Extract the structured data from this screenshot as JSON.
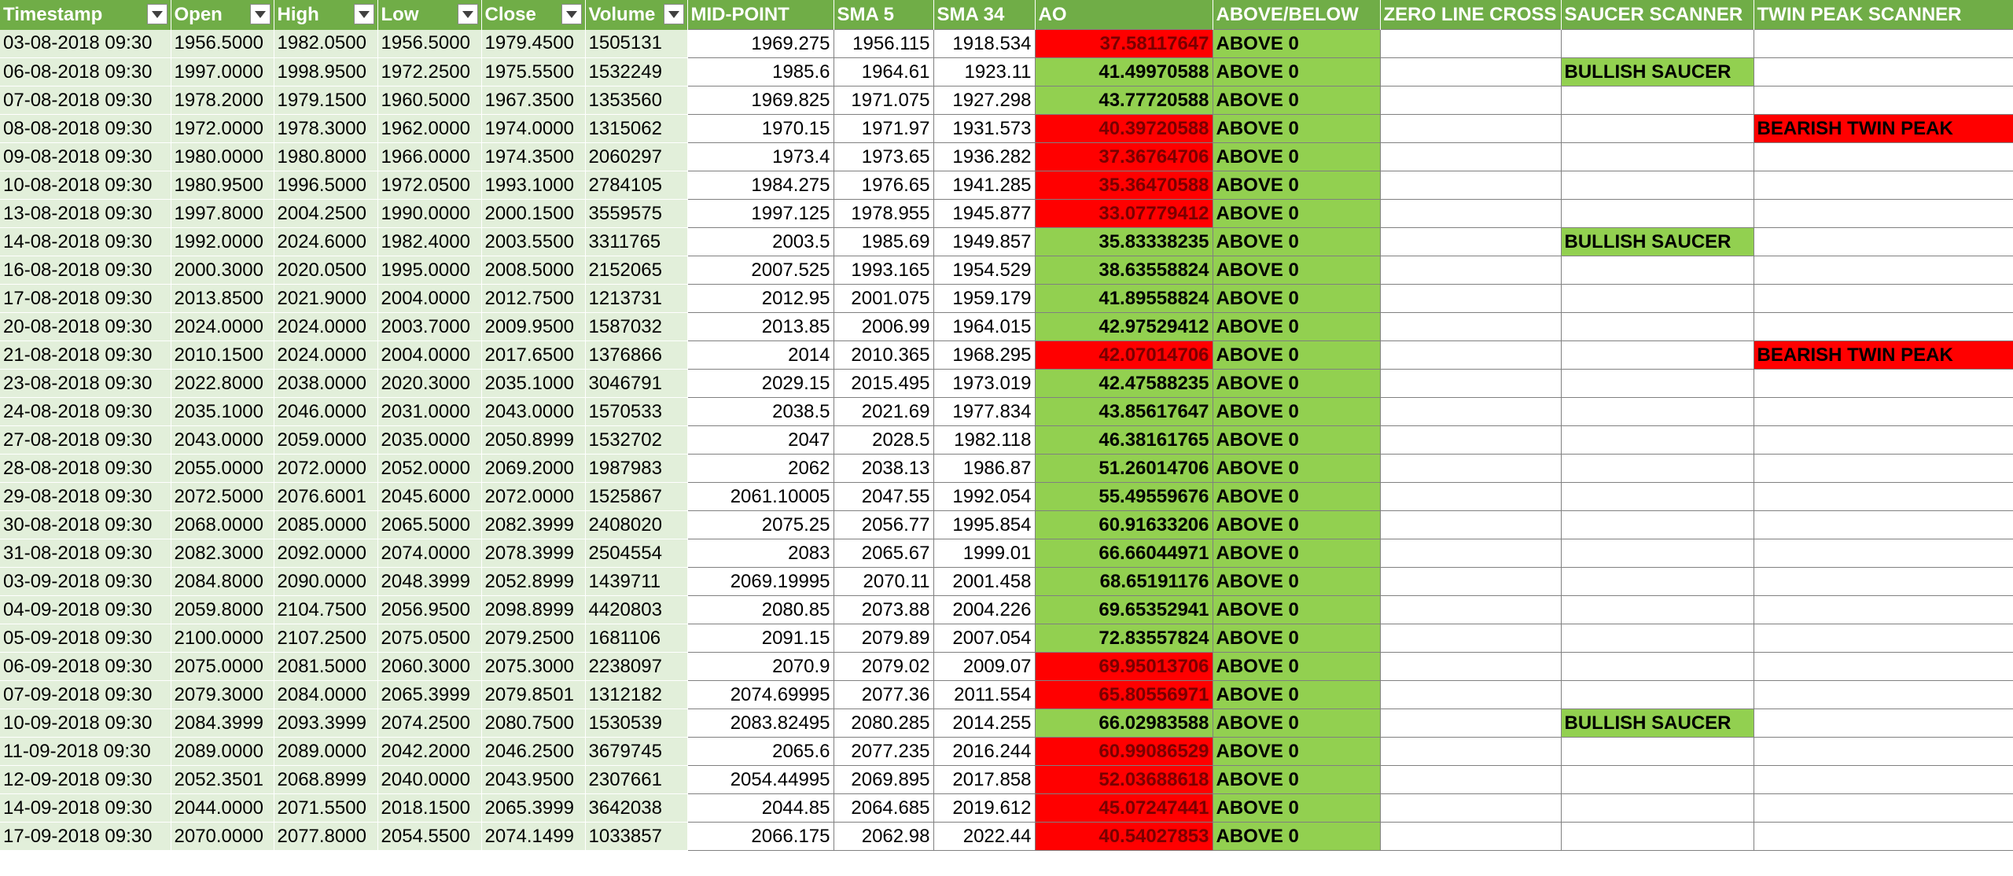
{
  "colors": {
    "header_bg": "#70ad47",
    "band_bg": "#e2efda",
    "green_fill": "#92d050",
    "red_fill": "#ff0000"
  },
  "icons": {
    "filter": "filter-dropdown-arrow-icon"
  },
  "headers": [
    {
      "label": "Timestamp",
      "filter": true
    },
    {
      "label": "Open",
      "filter": true
    },
    {
      "label": "High",
      "filter": true
    },
    {
      "label": "Low",
      "filter": true
    },
    {
      "label": "Close",
      "filter": true
    },
    {
      "label": "Volume",
      "filter": true
    },
    {
      "label": "MID-POINT",
      "filter": false
    },
    {
      "label": "SMA 5",
      "filter": false
    },
    {
      "label": "SMA 34",
      "filter": false
    },
    {
      "label": "AO",
      "filter": false
    },
    {
      "label": "ABOVE/BELOW",
      "filter": false
    },
    {
      "label": "ZERO LINE CROSS",
      "filter": false
    },
    {
      "label": "SAUCER SCANNER",
      "filter": false
    },
    {
      "label": "TWIN PEAK SCANNER",
      "filter": false
    }
  ],
  "rows": [
    {
      "ts": "03-08-2018 09:30",
      "open": "1956.5000",
      "high": "1982.0500",
      "low": "1956.5000",
      "close": "1979.4500",
      "volume": "1505131",
      "mid": "1969.275",
      "sma5": "1956.115",
      "sma34": "1918.534",
      "ao": "37.58117647",
      "ao_color": "red",
      "ab": "ABOVE 0",
      "zlc": "",
      "saucer": "",
      "twin": ""
    },
    {
      "ts": "06-08-2018 09:30",
      "open": "1997.0000",
      "high": "1998.9500",
      "low": "1972.2500",
      "close": "1975.5500",
      "volume": "1532249",
      "mid": "1985.6",
      "sma5": "1964.61",
      "sma34": "1923.11",
      "ao": "41.49970588",
      "ao_color": "green",
      "ab": "ABOVE 0",
      "zlc": "",
      "saucer": "BULLISH SAUCER",
      "twin": ""
    },
    {
      "ts": "07-08-2018 09:30",
      "open": "1978.2000",
      "high": "1979.1500",
      "low": "1960.5000",
      "close": "1967.3500",
      "volume": "1353560",
      "mid": "1969.825",
      "sma5": "1971.075",
      "sma34": "1927.298",
      "ao": "43.77720588",
      "ao_color": "green",
      "ab": "ABOVE 0",
      "zlc": "",
      "saucer": "",
      "twin": ""
    },
    {
      "ts": "08-08-2018 09:30",
      "open": "1972.0000",
      "high": "1978.3000",
      "low": "1962.0000",
      "close": "1974.0000",
      "volume": "1315062",
      "mid": "1970.15",
      "sma5": "1971.97",
      "sma34": "1931.573",
      "ao": "40.39720588",
      "ao_color": "red",
      "ab": "ABOVE 0",
      "zlc": "",
      "saucer": "",
      "twin": "BEARISH TWIN PEAK"
    },
    {
      "ts": "09-08-2018 09:30",
      "open": "1980.0000",
      "high": "1980.8000",
      "low": "1966.0000",
      "close": "1974.3500",
      "volume": "2060297",
      "mid": "1973.4",
      "sma5": "1973.65",
      "sma34": "1936.282",
      "ao": "37.36764706",
      "ao_color": "red",
      "ab": "ABOVE 0",
      "zlc": "",
      "saucer": "",
      "twin": ""
    },
    {
      "ts": "10-08-2018 09:30",
      "open": "1980.9500",
      "high": "1996.5000",
      "low": "1972.0500",
      "close": "1993.1000",
      "volume": "2784105",
      "mid": "1984.275",
      "sma5": "1976.65",
      "sma34": "1941.285",
      "ao": "35.36470588",
      "ao_color": "red",
      "ab": "ABOVE 0",
      "zlc": "",
      "saucer": "",
      "twin": ""
    },
    {
      "ts": "13-08-2018 09:30",
      "open": "1997.8000",
      "high": "2004.2500",
      "low": "1990.0000",
      "close": "2000.1500",
      "volume": "3559575",
      "mid": "1997.125",
      "sma5": "1978.955",
      "sma34": "1945.877",
      "ao": "33.07779412",
      "ao_color": "red",
      "ab": "ABOVE 0",
      "zlc": "",
      "saucer": "",
      "twin": ""
    },
    {
      "ts": "14-08-2018 09:30",
      "open": "1992.0000",
      "high": "2024.6000",
      "low": "1982.4000",
      "close": "2003.5500",
      "volume": "3311765",
      "mid": "2003.5",
      "sma5": "1985.69",
      "sma34": "1949.857",
      "ao": "35.83338235",
      "ao_color": "green",
      "ab": "ABOVE 0",
      "zlc": "",
      "saucer": "BULLISH SAUCER",
      "twin": ""
    },
    {
      "ts": "16-08-2018 09:30",
      "open": "2000.3000",
      "high": "2020.0500",
      "low": "1995.0000",
      "close": "2008.5000",
      "volume": "2152065",
      "mid": "2007.525",
      "sma5": "1993.165",
      "sma34": "1954.529",
      "ao": "38.63558824",
      "ao_color": "green",
      "ab": "ABOVE 0",
      "zlc": "",
      "saucer": "",
      "twin": ""
    },
    {
      "ts": "17-08-2018 09:30",
      "open": "2013.8500",
      "high": "2021.9000",
      "low": "2004.0000",
      "close": "2012.7500",
      "volume": "1213731",
      "mid": "2012.95",
      "sma5": "2001.075",
      "sma34": "1959.179",
      "ao": "41.89558824",
      "ao_color": "green",
      "ab": "ABOVE 0",
      "zlc": "",
      "saucer": "",
      "twin": ""
    },
    {
      "ts": "20-08-2018 09:30",
      "open": "2024.0000",
      "high": "2024.0000",
      "low": "2003.7000",
      "close": "2009.9500",
      "volume": "1587032",
      "mid": "2013.85",
      "sma5": "2006.99",
      "sma34": "1964.015",
      "ao": "42.97529412",
      "ao_color": "green",
      "ab": "ABOVE 0",
      "zlc": "",
      "saucer": "",
      "twin": ""
    },
    {
      "ts": "21-08-2018 09:30",
      "open": "2010.1500",
      "high": "2024.0000",
      "low": "2004.0000",
      "close": "2017.6500",
      "volume": "1376866",
      "mid": "2014",
      "sma5": "2010.365",
      "sma34": "1968.295",
      "ao": "42.07014706",
      "ao_color": "red",
      "ab": "ABOVE 0",
      "zlc": "",
      "saucer": "",
      "twin": "BEARISH TWIN PEAK"
    },
    {
      "ts": "23-08-2018 09:30",
      "open": "2022.8000",
      "high": "2038.0000",
      "low": "2020.3000",
      "close": "2035.1000",
      "volume": "3046791",
      "mid": "2029.15",
      "sma5": "2015.495",
      "sma34": "1973.019",
      "ao": "42.47588235",
      "ao_color": "green",
      "ab": "ABOVE 0",
      "zlc": "",
      "saucer": "",
      "twin": ""
    },
    {
      "ts": "24-08-2018 09:30",
      "open": "2035.1000",
      "high": "2046.0000",
      "low": "2031.0000",
      "close": "2043.0000",
      "volume": "1570533",
      "mid": "2038.5",
      "sma5": "2021.69",
      "sma34": "1977.834",
      "ao": "43.85617647",
      "ao_color": "green",
      "ab": "ABOVE 0",
      "zlc": "",
      "saucer": "",
      "twin": ""
    },
    {
      "ts": "27-08-2018 09:30",
      "open": "2043.0000",
      "high": "2059.0000",
      "low": "2035.0000",
      "close": "2050.8999",
      "volume": "1532702",
      "mid": "2047",
      "sma5": "2028.5",
      "sma34": "1982.118",
      "ao": "46.38161765",
      "ao_color": "green",
      "ab": "ABOVE 0",
      "zlc": "",
      "saucer": "",
      "twin": ""
    },
    {
      "ts": "28-08-2018 09:30",
      "open": "2055.0000",
      "high": "2072.0000",
      "low": "2052.0000",
      "close": "2069.2000",
      "volume": "1987983",
      "mid": "2062",
      "sma5": "2038.13",
      "sma34": "1986.87",
      "ao": "51.26014706",
      "ao_color": "green",
      "ab": "ABOVE 0",
      "zlc": "",
      "saucer": "",
      "twin": ""
    },
    {
      "ts": "29-08-2018 09:30",
      "open": "2072.5000",
      "high": "2076.6001",
      "low": "2045.6000",
      "close": "2072.0000",
      "volume": "1525867",
      "mid": "2061.10005",
      "sma5": "2047.55",
      "sma34": "1992.054",
      "ao": "55.49559676",
      "ao_color": "green",
      "ab": "ABOVE 0",
      "zlc": "",
      "saucer": "",
      "twin": ""
    },
    {
      "ts": "30-08-2018 09:30",
      "open": "2068.0000",
      "high": "2085.0000",
      "low": "2065.5000",
      "close": "2082.3999",
      "volume": "2408020",
      "mid": "2075.25",
      "sma5": "2056.77",
      "sma34": "1995.854",
      "ao": "60.91633206",
      "ao_color": "green",
      "ab": "ABOVE 0",
      "zlc": "",
      "saucer": "",
      "twin": ""
    },
    {
      "ts": "31-08-2018 09:30",
      "open": "2082.3000",
      "high": "2092.0000",
      "low": "2074.0000",
      "close": "2078.3999",
      "volume": "2504554",
      "mid": "2083",
      "sma5": "2065.67",
      "sma34": "1999.01",
      "ao": "66.66044971",
      "ao_color": "green",
      "ab": "ABOVE 0",
      "zlc": "",
      "saucer": "",
      "twin": ""
    },
    {
      "ts": "03-09-2018 09:30",
      "open": "2084.8000",
      "high": "2090.0000",
      "low": "2048.3999",
      "close": "2052.8999",
      "volume": "1439711",
      "mid": "2069.19995",
      "sma5": "2070.11",
      "sma34": "2001.458",
      "ao": "68.65191176",
      "ao_color": "green",
      "ab": "ABOVE 0",
      "zlc": "",
      "saucer": "",
      "twin": ""
    },
    {
      "ts": "04-09-2018 09:30",
      "open": "2059.8000",
      "high": "2104.7500",
      "low": "2056.9500",
      "close": "2098.8999",
      "volume": "4420803",
      "mid": "2080.85",
      "sma5": "2073.88",
      "sma34": "2004.226",
      "ao": "69.65352941",
      "ao_color": "green",
      "ab": "ABOVE 0",
      "zlc": "",
      "saucer": "",
      "twin": ""
    },
    {
      "ts": "05-09-2018 09:30",
      "open": "2100.0000",
      "high": "2107.2500",
      "low": "2075.0500",
      "close": "2079.2500",
      "volume": "1681106",
      "mid": "2091.15",
      "sma5": "2079.89",
      "sma34": "2007.054",
      "ao": "72.83557824",
      "ao_color": "green",
      "ab": "ABOVE 0",
      "zlc": "",
      "saucer": "",
      "twin": ""
    },
    {
      "ts": "06-09-2018 09:30",
      "open": "2075.0000",
      "high": "2081.5000",
      "low": "2060.3000",
      "close": "2075.3000",
      "volume": "2238097",
      "mid": "2070.9",
      "sma5": "2079.02",
      "sma34": "2009.07",
      "ao": "69.95013706",
      "ao_color": "red",
      "ab": "ABOVE 0",
      "zlc": "",
      "saucer": "",
      "twin": ""
    },
    {
      "ts": "07-09-2018 09:30",
      "open": "2079.3000",
      "high": "2084.0000",
      "low": "2065.3999",
      "close": "2079.8501",
      "volume": "1312182",
      "mid": "2074.69995",
      "sma5": "2077.36",
      "sma34": "2011.554",
      "ao": "65.80556971",
      "ao_color": "red",
      "ab": "ABOVE 0",
      "zlc": "",
      "saucer": "",
      "twin": ""
    },
    {
      "ts": "10-09-2018 09:30",
      "open": "2084.3999",
      "high": "2093.3999",
      "low": "2074.2500",
      "close": "2080.7500",
      "volume": "1530539",
      "mid": "2083.82495",
      "sma5": "2080.285",
      "sma34": "2014.255",
      "ao": "66.02983588",
      "ao_color": "green",
      "ab": "ABOVE 0",
      "zlc": "",
      "saucer": "BULLISH SAUCER",
      "twin": ""
    },
    {
      "ts": "11-09-2018 09:30",
      "open": "2089.0000",
      "high": "2089.0000",
      "low": "2042.2000",
      "close": "2046.2500",
      "volume": "3679745",
      "mid": "2065.6",
      "sma5": "2077.235",
      "sma34": "2016.244",
      "ao": "60.99086529",
      "ao_color": "red",
      "ab": "ABOVE 0",
      "zlc": "",
      "saucer": "",
      "twin": ""
    },
    {
      "ts": "12-09-2018 09:30",
      "open": "2052.3501",
      "high": "2068.8999",
      "low": "2040.0000",
      "close": "2043.9500",
      "volume": "2307661",
      "mid": "2054.44995",
      "sma5": "2069.895",
      "sma34": "2017.858",
      "ao": "52.03688618",
      "ao_color": "red",
      "ab": "ABOVE 0",
      "zlc": "",
      "saucer": "",
      "twin": ""
    },
    {
      "ts": "14-09-2018 09:30",
      "open": "2044.0000",
      "high": "2071.5500",
      "low": "2018.1500",
      "close": "2065.3999",
      "volume": "3642038",
      "mid": "2044.85",
      "sma5": "2064.685",
      "sma34": "2019.612",
      "ao": "45.07247441",
      "ao_color": "red",
      "ab": "ABOVE 0",
      "zlc": "",
      "saucer": "",
      "twin": ""
    },
    {
      "ts": "17-09-2018 09:30",
      "open": "2070.0000",
      "high": "2077.8000",
      "low": "2054.5500",
      "close": "2074.1499",
      "volume": "1033857",
      "mid": "2066.175",
      "sma5": "2062.98",
      "sma34": "2022.44",
      "ao": "40.54027853",
      "ao_color": "red",
      "ab": "ABOVE 0",
      "zlc": "",
      "saucer": "",
      "twin": ""
    }
  ]
}
